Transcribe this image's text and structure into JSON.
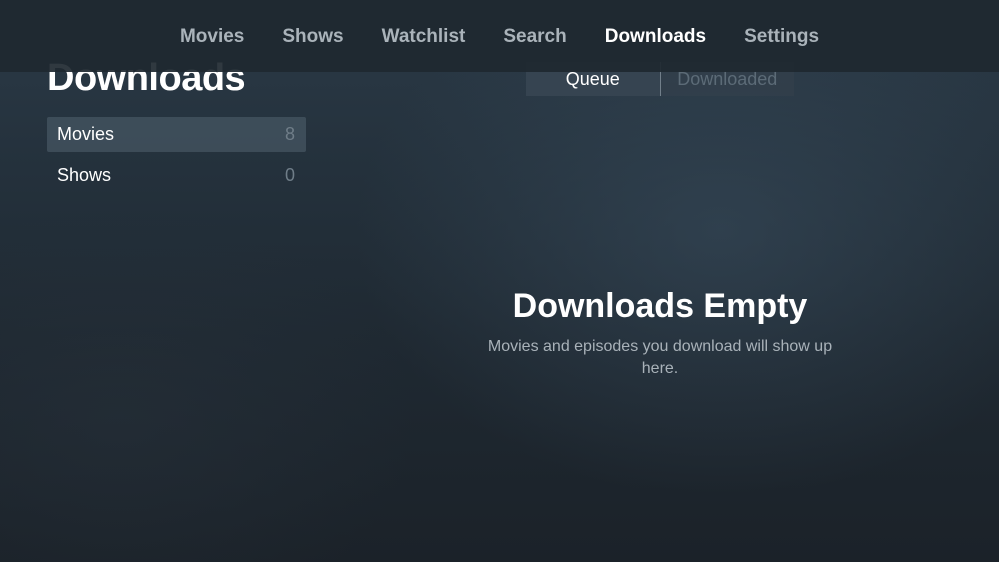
{
  "nav": {
    "items": [
      {
        "label": "Movies"
      },
      {
        "label": "Shows"
      },
      {
        "label": "Watchlist"
      },
      {
        "label": "Search"
      },
      {
        "label": "Downloads"
      },
      {
        "label": "Settings"
      }
    ],
    "active": "Downloads"
  },
  "page": {
    "title": "Downloads"
  },
  "segmented": {
    "selected": "Queue",
    "other": "Downloaded"
  },
  "sidebar": {
    "items": [
      {
        "label": "Movies",
        "count": "8",
        "selected": true
      },
      {
        "label": "Shows",
        "count": "0",
        "selected": false
      }
    ]
  },
  "empty_state": {
    "title": "Downloads Empty",
    "message": "Movies and episodes you download will show up here."
  },
  "colors": {
    "background": "#24313c",
    "nav_inactive": "#aab3ba",
    "nav_active": "#ffffff",
    "count_text": "#6f7d88",
    "message_text": "#a9b2b9"
  }
}
